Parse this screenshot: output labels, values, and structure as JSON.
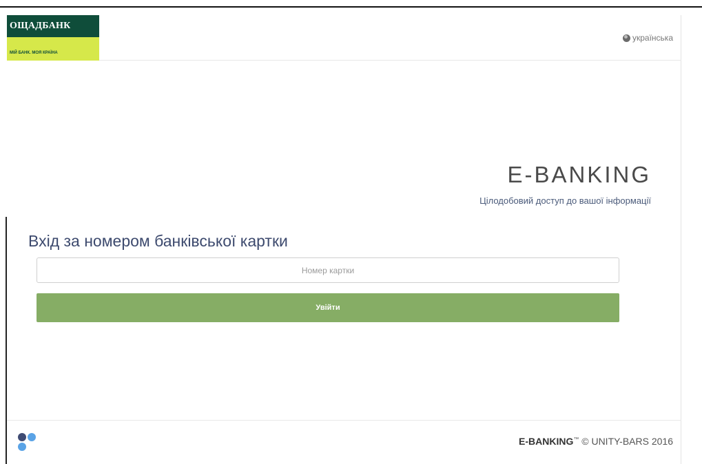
{
  "header": {
    "logo": {
      "name": "ОЩАДБАНК",
      "slogan": "МІЙ БАНК. МОЯ КРАЇНА",
      "colors": {
        "primary": "#0f4d3a",
        "accent": "#d6e84a"
      }
    },
    "language": {
      "icon": "globe-icon",
      "label": "українська"
    }
  },
  "brand": {
    "title": "E-BANKING",
    "subtitle": "Цілодобовий доступ до вашої інформації"
  },
  "login": {
    "title": "Вхід за номером банківської картки",
    "card_input": {
      "placeholder": "Номер картки",
      "value": ""
    },
    "submit_label": "Увійти",
    "button_color": "#86ad65"
  },
  "footer": {
    "logo_icon": "unity-bars-dots-icon",
    "product": "E-BANKING",
    "tm": "™",
    "copyright": " © UNITY-BARS 2016"
  }
}
